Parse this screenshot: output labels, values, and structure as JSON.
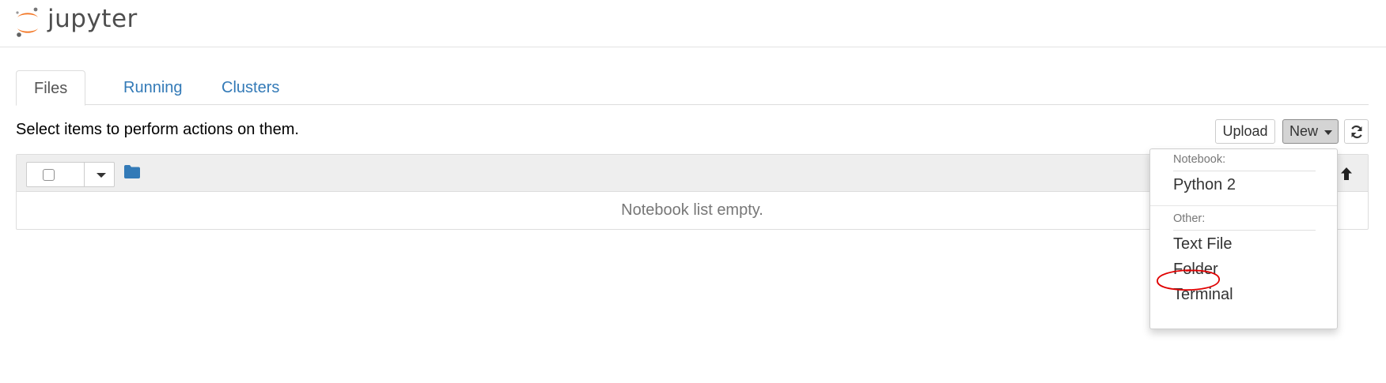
{
  "app": {
    "logo_text": "jupyter"
  },
  "tabs": [
    {
      "label": "Files",
      "active": true
    },
    {
      "label": "Running",
      "active": false
    },
    {
      "label": "Clusters",
      "active": false
    }
  ],
  "toolbar": {
    "instructions": "Select items to perform actions on them.",
    "upload_label": "Upload",
    "new_label": "New"
  },
  "notebook_list": {
    "empty_message": "Notebook list empty."
  },
  "new_menu": {
    "notebook_header": "Notebook:",
    "notebook_items": [
      "Python 2"
    ],
    "other_header": "Other:",
    "other_items": [
      "Text File",
      "Folder",
      "Terminal"
    ],
    "highlighted_item": "Folder"
  },
  "colors": {
    "link": "#337ab7",
    "logo_orange": "#f37726",
    "annotation": "#e00000"
  },
  "icons": [
    "jupyter-logo-icon",
    "chevron-down-icon",
    "folder-icon",
    "refresh-icon",
    "arrow-up-icon"
  ]
}
